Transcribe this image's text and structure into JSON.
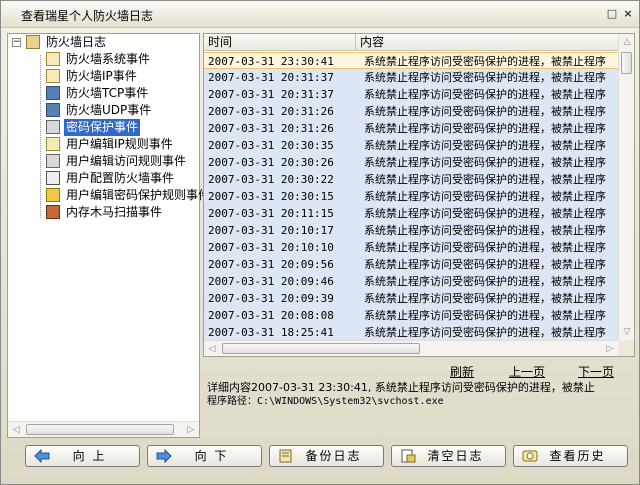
{
  "window": {
    "title": "查看瑞星个人防火墙日志",
    "restore_glyph": "□",
    "close_glyph": "×"
  },
  "tree": {
    "root": {
      "label": "防火墙日志",
      "toggle": "−"
    },
    "items": [
      {
        "label": "防火墙系统事件",
        "icon": "doc-icon"
      },
      {
        "label": "防火墙IP事件",
        "icon": "ip-doc-icon"
      },
      {
        "label": "防火墙TCP事件",
        "icon": "computer-icon"
      },
      {
        "label": "防火墙UDP事件",
        "icon": "computer-icon"
      },
      {
        "label": "密码保护事件",
        "icon": "exe-icon",
        "selected": true
      },
      {
        "label": "用户编辑IP规则事件",
        "icon": "ip-doc-icon"
      },
      {
        "label": "用户编辑访问规则事件",
        "icon": "exe-icon"
      },
      {
        "label": "用户配置防火墙事件",
        "icon": "config-icon"
      },
      {
        "label": "用户编辑密码保护规则事件",
        "icon": "key-icon"
      },
      {
        "label": "内存木马扫描事件",
        "icon": "scan-icon"
      }
    ]
  },
  "list": {
    "columns": [
      "时间",
      "内容"
    ],
    "rows": [
      {
        "time": "2007-03-31 23:30:41",
        "content": "系统禁止程序访问受密码保护的进程，被禁止程序"
      },
      {
        "time": "2007-03-31 20:31:37",
        "content": "系统禁止程序访问受密码保护的进程，被禁止程序"
      },
      {
        "time": "2007-03-31 20:31:37",
        "content": "系统禁止程序访问受密码保护的进程，被禁止程序"
      },
      {
        "time": "2007-03-31 20:31:26",
        "content": "系统禁止程序访问受密码保护的进程，被禁止程序"
      },
      {
        "time": "2007-03-31 20:31:26",
        "content": "系统禁止程序访问受密码保护的进程，被禁止程序"
      },
      {
        "time": "2007-03-31 20:30:35",
        "content": "系统禁止程序访问受密码保护的进程，被禁止程序"
      },
      {
        "time": "2007-03-31 20:30:26",
        "content": "系统禁止程序访问受密码保护的进程，被禁止程序"
      },
      {
        "time": "2007-03-31 20:30:22",
        "content": "系统禁止程序访问受密码保护的进程，被禁止程序"
      },
      {
        "time": "2007-03-31 20:30:15",
        "content": "系统禁止程序访问受密码保护的进程，被禁止程序"
      },
      {
        "time": "2007-03-31 20:11:15",
        "content": "系统禁止程序访问受密码保护的进程，被禁止程序"
      },
      {
        "time": "2007-03-31 20:10:17",
        "content": "系统禁止程序访问受密码保护的进程，被禁止程序"
      },
      {
        "time": "2007-03-31 20:10:10",
        "content": "系统禁止程序访问受密码保护的进程，被禁止程序"
      },
      {
        "time": "2007-03-31 20:09:56",
        "content": "系统禁止程序访问受密码保护的进程，被禁止程序"
      },
      {
        "time": "2007-03-31 20:09:46",
        "content": "系统禁止程序访问受密码保护的进程，被禁止程序"
      },
      {
        "time": "2007-03-31 20:09:39",
        "content": "系统禁止程序访问受密码保护的进程，被禁止程序"
      },
      {
        "time": "2007-03-31 20:08:08",
        "content": "系统禁止程序访问受密码保护的进程，被禁止程序"
      },
      {
        "time": "2007-03-31 18:25:41",
        "content": "系统禁止程序访问受密码保护的进程，被禁止程序"
      }
    ]
  },
  "pager": {
    "refresh": "刷新",
    "prev": "上一页",
    "next": "下一页"
  },
  "detail": {
    "line1": "详细内容2007-03-31 23:30:41, 系统禁止程序访问受密码保护的进程，被禁止",
    "line2": "程序路径：C:\\WINDOWS\\System32\\svchost.exe"
  },
  "buttons": {
    "up": "向 上",
    "down": "向 下",
    "backup": "备份日志",
    "clear": "清空日志",
    "history": "查看历史"
  },
  "scroll_arrows": {
    "left": "◁",
    "right": "▷",
    "up": "△",
    "down": "▽"
  }
}
